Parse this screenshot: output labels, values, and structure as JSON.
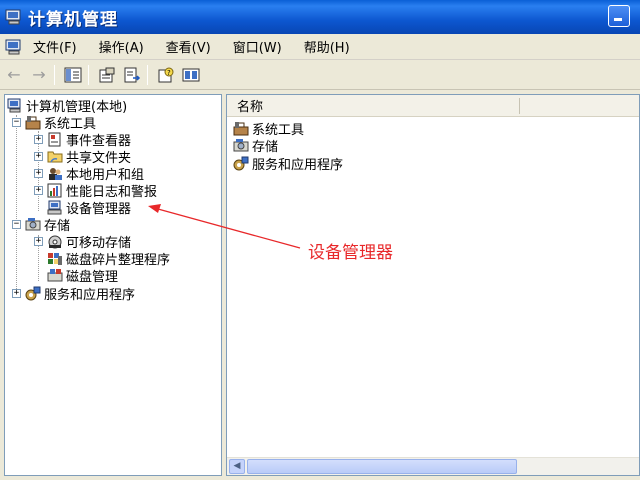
{
  "window": {
    "title": "计算机管理"
  },
  "menu": {
    "items": [
      "文件(F)",
      "操作(A)",
      "查看(V)",
      "窗口(W)",
      "帮助(H)"
    ]
  },
  "toolbar": {
    "buttons": [
      "back-arrow-icon",
      "forward-arrow-icon",
      "show-hide-tree-icon",
      "properties-icon",
      "export-icon",
      "help-icon",
      "mmc-icon"
    ]
  },
  "tree": {
    "root": "计算机管理(本地)",
    "system_tools": "系统工具",
    "event_viewer": "事件查看器",
    "shared_folders": "共享文件夹",
    "local_users": "本地用户和组",
    "perf_logs": "性能日志和警报",
    "device_manager": "设备管理器",
    "storage": "存储",
    "removable_storage": "可移动存储",
    "defrag": "磁盘碎片整理程序",
    "disk_mgmt": "磁盘管理",
    "services_apps": "服务和应用程序"
  },
  "right_pane": {
    "column_header": "名称",
    "items": [
      "系统工具",
      "存储",
      "服务和应用程序"
    ]
  },
  "annotation": {
    "callout_text": "设备管理器",
    "color": "#e8282a"
  }
}
